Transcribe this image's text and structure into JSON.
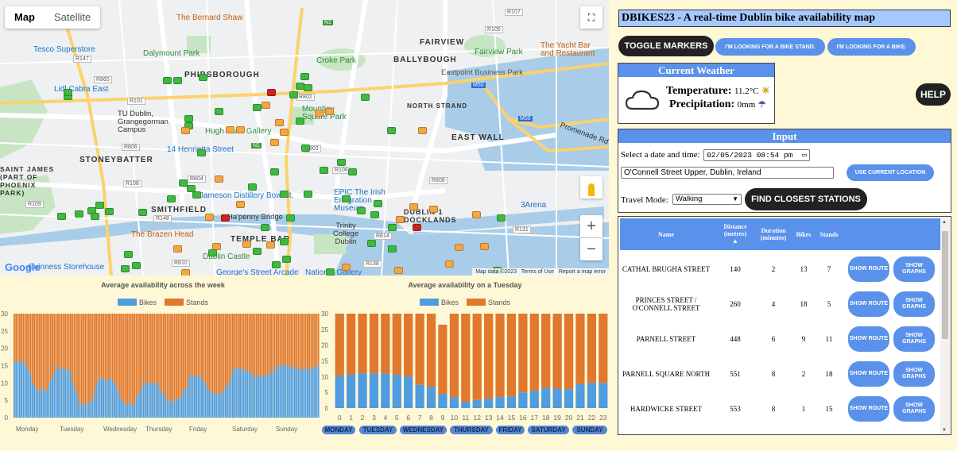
{
  "map": {
    "type_tabs": [
      "Map",
      "Satellite"
    ],
    "fullscreen_icon": "fullscreen-icon",
    "pegman_icon": "pegman-icon",
    "zoom_in": "+",
    "zoom_out": "−",
    "logo": "Google",
    "footer": [
      "Map data ©2023",
      "Terms of Use",
      "Report a map error"
    ],
    "labels": {
      "areas": [
        "PHIBSBOROUGH",
        "STONEYBATTER",
        "SMITHFIELD",
        "NORTH STRAND",
        "EAST WALL",
        "BALLYBOUGH",
        "FAIRVIEW",
        "DUBLIN 1 DOCKLANDS",
        "TEMPLE BAR",
        "SAINT JAMES (PART OF PHOENIX PARK)"
      ],
      "places_green": [
        "Dalymount Park",
        "Croke Park",
        "Fairview Park",
        "Mountjoy Square Park",
        "Hugh Lane Gallery",
        "TU Dublin, Grangegorman Campus",
        "Dublin Castle",
        "Trinity College Dublin",
        "Eastpoint Business Park"
      ],
      "places_blue": [
        "Tesco Superstore",
        "Lidl Cabra East",
        "14 Henrietta Street",
        "Jameson Distillery Bow St.",
        "EPIC The Irish Emigration Museum",
        "3Arena",
        "Guinness Storehouse",
        "George's Street Arcade",
        "National Gallery"
      ],
      "places_orange": [
        "The Bernard Shaw",
        "The Brazen Head",
        "The Yacht Bar and Restaurant"
      ],
      "other": [
        "Ha'penny Bridge",
        "Promenade Rd"
      ],
      "roads": [
        "R147",
        "R865",
        "R101",
        "R806",
        "R804",
        "R108",
        "R148",
        "R109",
        "R810",
        "R107",
        "R105",
        "R803",
        "R802",
        "R131",
        "R814",
        "R138",
        "R106",
        "R808"
      ],
      "roads_green": [
        "N1"
      ],
      "roads_blue": [
        "M50"
      ]
    }
  },
  "charts": {
    "week": {
      "title": "Average availability across the week",
      "legend": [
        "Bikes",
        "Stands"
      ],
      "colors": {
        "bikes": "#4f9ce0",
        "stands": "#e0782d"
      }
    },
    "day": {
      "title": "Average availability on a Tuesday",
      "legend": [
        "Bikes",
        "Stands"
      ],
      "days": [
        "MONDAY",
        "TUESDAY",
        "WEDNESDAY",
        "THURSDAY",
        "FRIDAY",
        "SATURDAY",
        "SUNDAY"
      ]
    }
  },
  "chart_data": [
    {
      "type": "bar",
      "stacked": true,
      "title": "Average availability across the week",
      "x_tick_labels": [
        "Monday",
        "Tuesday",
        "Wednesday",
        "Thursday",
        "Friday",
        "Saturday",
        "Sunday"
      ],
      "ylim": [
        0,
        30
      ],
      "yticks": [
        0,
        5,
        10,
        15,
        20,
        25,
        30
      ],
      "series": [
        {
          "name": "Bikes",
          "daily_shape": [
            16,
            14,
            11,
            10,
            12,
            14,
            15
          ],
          "trough": [
            8,
            4,
            4,
            5,
            7,
            12,
            14
          ]
        },
        {
          "name": "Stands",
          "total": 30
        }
      ],
      "legend": "top-center"
    },
    {
      "type": "bar",
      "stacked": true,
      "title": "Average availability on a Tuesday",
      "categories": [
        "0",
        "1",
        "2",
        "3",
        "4",
        "5",
        "6",
        "7",
        "8",
        "9",
        "10",
        "11",
        "12",
        "13",
        "14",
        "15",
        "16",
        "17",
        "18",
        "19",
        "20",
        "21",
        "22",
        "23"
      ],
      "ylim": [
        0,
        30
      ],
      "yticks": [
        0,
        5,
        10,
        15,
        20,
        25,
        30
      ],
      "series": [
        {
          "name": "Bikes",
          "values": [
            10.2,
            10.7,
            11,
            11,
            11,
            10.6,
            10,
            7.4,
            6.7,
            4.5,
            3.5,
            2,
            2.6,
            3,
            3.5,
            3.7,
            5,
            5.5,
            6.4,
            6.2,
            6,
            7.6,
            8,
            8
          ]
        },
        {
          "name": "Stands",
          "values": [
            19.8,
            19.3,
            19,
            19,
            19,
            19.4,
            20,
            22.6,
            23.3,
            22,
            26.5,
            28,
            27.4,
            27,
            26.5,
            26.3,
            25,
            24.5,
            23.6,
            23.8,
            24,
            22.4,
            22,
            22
          ]
        }
      ],
      "legend": "top-center"
    }
  ],
  "panel": {
    "app_title": "DBIKES23 - A real-time Dublin bike availability map",
    "toggle_label": "TOGGLE MARKERS",
    "stand_btn": "I'M LOOKING FOR A BIKE STAND.",
    "bike_btn": "I'M LOOKING FOR A BIKE.",
    "help_label": "HELP",
    "weather": {
      "title": "Current Weather",
      "icon": "cloud-icon",
      "temp_label": "Temperature:",
      "temp_value": "11.2°C",
      "temp_icon": "sun-icon",
      "precip_label": "Precipitation:",
      "precip_value": "0mm",
      "precip_icon": "umbrella-icon"
    },
    "input": {
      "title": "Input",
      "date_label": "Select a date and time:",
      "date_value": "02/05/2023 08:54 pm",
      "calendar_icon": "calendar-icon",
      "address_value": "O'Connell Street Upper, Dublin, Ireland",
      "location_btn": "USE CURRENT LOCATION",
      "mode_label": "Travel Mode:",
      "mode_value": "Walking",
      "find_btn": "FIND CLOSEST STATIONS"
    },
    "table": {
      "headers": {
        "name": "Name",
        "distance": "Distance (metres)",
        "sort_arrow": "▲",
        "duration": "Duration (minutes)",
        "bikes": "Bikes",
        "stands": "Stands"
      },
      "route_btn": "SHOW ROUTE",
      "graphs_btn": "SHOW GRAPHS",
      "rows": [
        {
          "name": "CATHAL BRUGHA STREET",
          "distance": "140",
          "duration": "2",
          "bikes": "13",
          "stands": "7"
        },
        {
          "name": "PRINCES STREET / O'CONNELL STREET",
          "distance": "260",
          "duration": "4",
          "bikes": "18",
          "stands": "5"
        },
        {
          "name": "PARNELL STREET",
          "distance": "448",
          "duration": "6",
          "bikes": "9",
          "stands": "11"
        },
        {
          "name": "PARNELL SQUARE NORTH",
          "distance": "551",
          "duration": "8",
          "bikes": "2",
          "stands": "18"
        },
        {
          "name": "HARDWICKE STREET",
          "distance": "553",
          "duration": "8",
          "bikes": "1",
          "stands": "15"
        }
      ]
    }
  }
}
